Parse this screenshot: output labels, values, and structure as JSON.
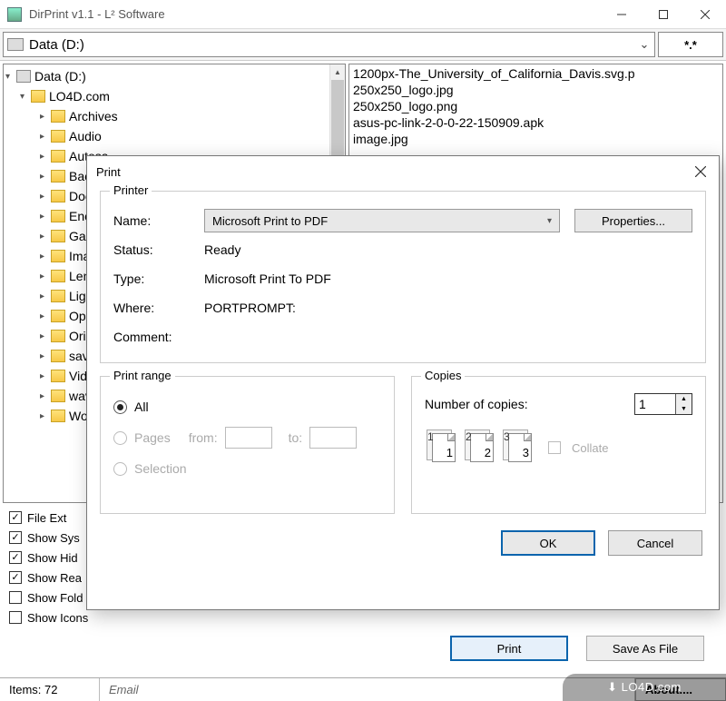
{
  "window": {
    "title": "DirPrint v1.1 - L² Software"
  },
  "drivebar": {
    "drive": "Data (D:)",
    "filter": "*.*"
  },
  "tree": {
    "root": "Data (D:)",
    "folder": "LO4D.com",
    "items": [
      "Archives",
      "Audio",
      "Autosa",
      "Backup",
      "Docume",
      "Encryp",
      "Gaming",
      "Images",
      "Lenovo",
      "Lightro",
      "Open",
      "Origin",
      "savepa",
      "Video",
      "wavpa",
      "Worksp"
    ]
  },
  "files": [
    "1200px-The_University_of_California_Davis.svg.p",
    "250x250_logo.jpg",
    "250x250_logo.png",
    "asus-pc-link-2-0-0-22-150909.apk",
    "image.jpg"
  ],
  "options": [
    {
      "label": "File Ext",
      "checked": true
    },
    {
      "label": "Show Sys",
      "checked": true
    },
    {
      "label": "Show Hid",
      "checked": true
    },
    {
      "label": "Show Rea",
      "checked": true
    },
    {
      "label": "Show Fold",
      "checked": false
    },
    {
      "label": "Show Icons",
      "checked": false
    }
  ],
  "buttons": {
    "print": "Print",
    "saveas": "Save As File"
  },
  "status": {
    "items": "Items: 72",
    "email": "Email",
    "about": "About...."
  },
  "watermark": "⬇ LO4D.com",
  "dialog": {
    "title": "Print",
    "printer": {
      "group": "Printer",
      "name_label": "Name:",
      "name": "Microsoft Print to PDF",
      "properties": "Properties...",
      "status_label": "Status:",
      "status": "Ready",
      "type_label": "Type:",
      "type": "Microsoft Print To PDF",
      "where_label": "Where:",
      "where": "PORTPROMPT:",
      "comment_label": "Comment:",
      "comment": ""
    },
    "range": {
      "group": "Print range",
      "all": "All",
      "pages": "Pages",
      "from": "from:",
      "to": "to:",
      "selection": "Selection"
    },
    "copies": {
      "group": "Copies",
      "label": "Number of copies:",
      "value": "1",
      "collate": "Collate",
      "p1": "1",
      "p2": "2",
      "p3": "3"
    },
    "ok": "OK",
    "cancel": "Cancel"
  }
}
